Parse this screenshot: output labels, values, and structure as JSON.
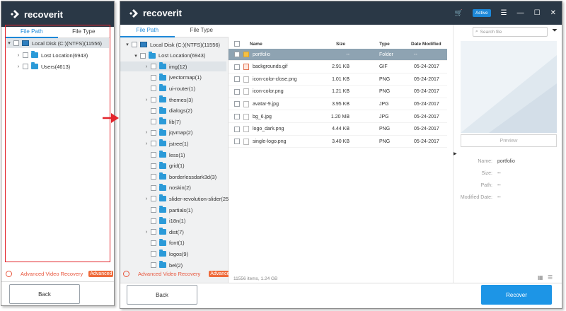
{
  "app": {
    "name": "recoverit"
  },
  "small_window": {
    "tabs": [
      "File Path",
      "File Type"
    ],
    "tree": [
      {
        "label": "Local Disk (C:)(NTFS)(11556)",
        "level": 0,
        "expanded": true,
        "type": "disk"
      },
      {
        "label": "Lost Location(6943)",
        "level": 1,
        "expanded": false,
        "type": "folder"
      },
      {
        "label": "Users(4613)",
        "level": 1,
        "expanded": false,
        "type": "folder"
      }
    ],
    "advanced_label": "Advanced Video Recovery",
    "advanced_badge": "Advanced",
    "back_label": "Back"
  },
  "main_window": {
    "badge": "Active",
    "tabs": [
      "File Path",
      "File Type"
    ],
    "tree": [
      {
        "label": "Local Disk (C:)(NTFS)(11556)",
        "level": 0,
        "expanded": true,
        "type": "disk"
      },
      {
        "label": "Lost Location(6943)",
        "level": 1,
        "expanded": true,
        "type": "folder"
      },
      {
        "label": "img(12)",
        "level": 2,
        "expandable": true,
        "selected": true,
        "type": "folder"
      },
      {
        "label": "jvectormap(1)",
        "level": 2,
        "type": "folder"
      },
      {
        "label": "ui-router(1)",
        "level": 2,
        "type": "folder"
      },
      {
        "label": "themes(3)",
        "level": 2,
        "expandable": true,
        "type": "folder"
      },
      {
        "label": "dialogs(2)",
        "level": 2,
        "type": "folder"
      },
      {
        "label": "lib(7)",
        "level": 2,
        "type": "folder"
      },
      {
        "label": "jqvmap(2)",
        "level": 2,
        "expandable": true,
        "type": "folder"
      },
      {
        "label": "jstree(1)",
        "level": 2,
        "expandable": true,
        "type": "folder"
      },
      {
        "label": "less(1)",
        "level": 2,
        "type": "folder"
      },
      {
        "label": "grid(1)",
        "level": 2,
        "type": "folder"
      },
      {
        "label": "borderlessdark3d(3)",
        "level": 2,
        "type": "folder"
      },
      {
        "label": "noskin(2)",
        "level": 2,
        "type": "folder"
      },
      {
        "label": "slider-revolution-slider(25",
        "level": 2,
        "expandable": true,
        "type": "folder"
      },
      {
        "label": "partials(1)",
        "level": 2,
        "type": "folder"
      },
      {
        "label": "i18n(1)",
        "level": 2,
        "type": "folder"
      },
      {
        "label": "dist(7)",
        "level": 2,
        "expandable": true,
        "type": "folder"
      },
      {
        "label": "font(1)",
        "level": 2,
        "type": "folder"
      },
      {
        "label": "logos(9)",
        "level": 2,
        "type": "folder"
      },
      {
        "label": "bel(2)",
        "level": 2,
        "type": "folder"
      }
    ],
    "advanced_label": "Advanced Video Recovery",
    "advanced_badge": "Advanced",
    "columns": {
      "name": "Name",
      "size": "Size",
      "type": "Type",
      "date": "Date Modified"
    },
    "files": [
      {
        "name": "portfolio",
        "size": "--",
        "type": "Folder",
        "date": "--",
        "icon": "folder",
        "selected": true
      },
      {
        "name": "backgrounds.gif",
        "size": "2.91  KB",
        "type": "GIF",
        "date": "05-24-2017",
        "icon": "image"
      },
      {
        "name": "icon-color-close.png",
        "size": "1.01  KB",
        "type": "PNG",
        "date": "05-24-2017",
        "icon": "file"
      },
      {
        "name": "icon-color.png",
        "size": "1.21  KB",
        "type": "PNG",
        "date": "05-24-2017",
        "icon": "file"
      },
      {
        "name": "avatar-9.jpg",
        "size": "3.95  KB",
        "type": "JPG",
        "date": "05-24-2017",
        "icon": "file"
      },
      {
        "name": "bg_6.jpg",
        "size": "1.20  MB",
        "type": "JPG",
        "date": "05-24-2017",
        "icon": "file"
      },
      {
        "name": "logo_dark.png",
        "size": "4.44  KB",
        "type": "PNG",
        "date": "05-24-2017",
        "icon": "file"
      },
      {
        "name": "single-logo.png",
        "size": "3.40  KB",
        "type": "PNG",
        "date": "05-24-2017",
        "icon": "file"
      }
    ],
    "search_placeholder": "Search file",
    "preview_label": "Preview",
    "properties": [
      {
        "key": "Name:",
        "value": "portfolio"
      },
      {
        "key": "Size:",
        "value": "--"
      },
      {
        "key": "Path:",
        "value": "--"
      },
      {
        "key": "Modified Date:",
        "value": "--"
      }
    ],
    "status": "11556 items, 1.24  GB",
    "back_label": "Back",
    "recover_label": "Recover"
  },
  "colors": {
    "titlebar": "#2a3846",
    "accent": "#1d88d8",
    "recover": "#1d95e6",
    "highlight": "#e3242b",
    "advanced": "#e8553c"
  }
}
